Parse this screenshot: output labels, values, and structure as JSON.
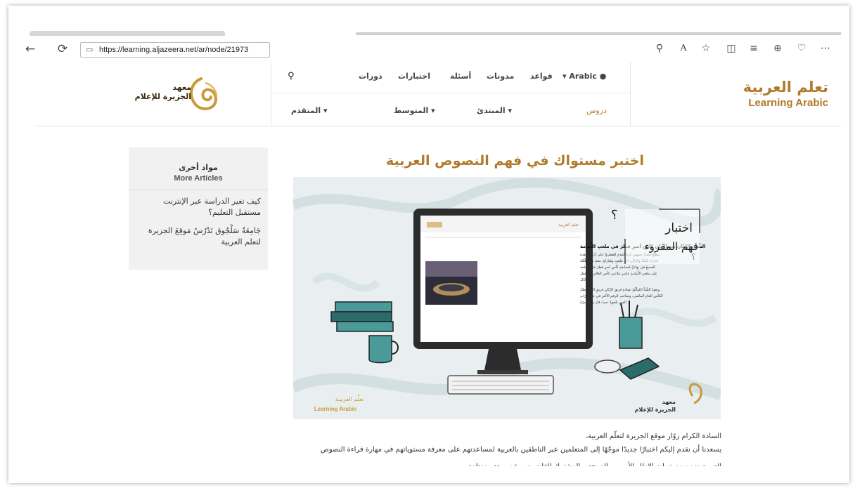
{
  "browser": {
    "url": "https://learning.aljazeera.net/ar/node/21973",
    "icons": [
      "back-icon",
      "refresh-icon",
      "lock-icon",
      "zoom-icon",
      "read-aloud-icon",
      "favorite-icon",
      "split-screen-icon",
      "favorites-bar-icon",
      "collections-icon",
      "performance-icon",
      "more-icon"
    ]
  },
  "header": {
    "brand_ar": "تعلم العربية",
    "brand_en": "Learning Arabic",
    "logo_ar_line1": "معهد",
    "logo_ar_line2": "الجزيرة للإعلام",
    "lang_label": "Arabic",
    "nav": [
      "قواعد",
      "مدونات",
      "أسئلة",
      "اختبارات",
      "دورات"
    ],
    "levels": [
      "دروس",
      "المبتدئ",
      "المتوسط",
      "المتقدم"
    ]
  },
  "main": {
    "title": "اختبر مستواك في فهم النصوص العربية",
    "hero": {
      "badge_line1": "اختبار",
      "badge_line2": "فهم المقروء",
      "corner_ar": "تعلّم العربيـة",
      "corner_en": "Learning Arabic",
      "logo_line1": "معهد",
      "logo_line2": "الجزيرة للإعلام",
      "screen_headline": "الشَّدُّ والرَّيَّانِ يتصالحانِ كأسَ أميرِ قطرَ في ملعبِ الثُّمامة",
      "screen_lines": [
        "يتطلّعُ أنصارُ جمهورِ كرةِ القدمِ القطريِّ على أنْ مُشاهدة",
        "مُباراةِ الشَّدِّ والرَّيَّانِ أحدِ ملعبٍ ومُباراةٍ، ينعمُ ما يتطلّعُهُ",
        "الجميعُ في نهائيِّ مُسابقةِ كأسِ أميرِ قطرَ غدًا الجُمُعة",
        "على ملعبِ الثُّمامةِ عاشرِ ملاعبِ كأسِ العالمِ في قطرَ",
        "2022.",
        "ويعودُ الشَّدُّ المُتألّقُ بقيادةِ فريقِ الرَّيّانِ فريقِ الشَّدِّ بطلُ",
        "الكأسِ العامِ الماضي، وصاحبِ الرقمِ الأكثرِ في عددِ مرّاتِ",
        "الفوزِ بلقَبها، حيثُ فازَ بهِ ١٧ مرّةً"
      ]
    },
    "paragraphs": [
      "السادة الكرام زوّار موقع الجزيرة لتعلّم العربية،",
      "يسعدنا أن نقدم إليكم اختبارًا جديدًا موجّهًا إلى المتعلمين عبر الناطقين بالعربية لمساعدتهم على معرفة مستوياتهم في مهارة قراءة النصوص",
      "العربية ضمن مستويات الإطار الأوروبي المرجعي المشترك للغات بصورة سريعة ومنظمة"
    ]
  },
  "sidebar": {
    "title_ar": "مواد أخرى",
    "title_en": "More Articles",
    "links": [
      "كيف تغير الدراسة عبر الإنترنت مستقبل التعليم؟",
      "جَامِعَةُ سَلْجُوق تَدْرُسُ مَوقِعَ الجزيرة لتعلم العربية"
    ]
  },
  "colors": {
    "brand": "#b07a2a",
    "sidebar_bg": "#f1f1f1",
    "hero_bg": "#e9eff0",
    "teal": "#4a9a9a"
  }
}
